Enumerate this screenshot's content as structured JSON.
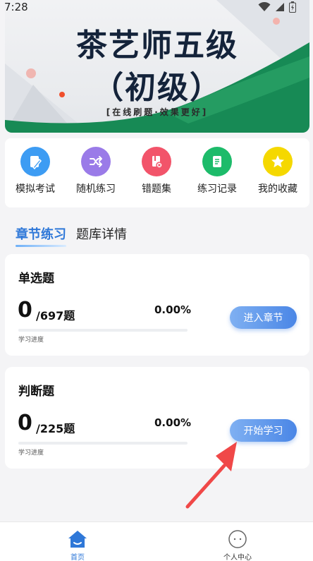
{
  "status": {
    "time": "7:28"
  },
  "banner": {
    "title_line1": "茶艺师五级",
    "title_line2": "（初级）",
    "subtitle": "[在线刷题·效果更好]"
  },
  "quick_actions": [
    {
      "label": "模拟考试",
      "icon": "exam-edit-icon",
      "color": "#3d9cf3"
    },
    {
      "label": "随机练习",
      "icon": "shuffle-icon",
      "color": "#9a7be8"
    },
    {
      "label": "错题集",
      "icon": "wrong-book-icon",
      "color": "#f2546a"
    },
    {
      "label": "练习记录",
      "icon": "record-icon",
      "color": "#1dbb6a"
    },
    {
      "label": "我的收藏",
      "icon": "star-icon",
      "color": "#f5d800"
    }
  ],
  "tabs": [
    {
      "label": "章节练习",
      "active": true
    },
    {
      "label": "题库详情",
      "active": false
    }
  ],
  "chapters": [
    {
      "name": "单选题",
      "done": "0",
      "total": "/697题",
      "percent": "0.00%",
      "progress": 0,
      "progress_label": "学习进度",
      "button": "进入章节"
    },
    {
      "name": "判断题",
      "done": "0",
      "total": "/225题",
      "percent": "0.00%",
      "progress": 0,
      "progress_label": "学习进度",
      "button": "开始学习"
    }
  ],
  "nav": [
    {
      "label": "首页",
      "icon": "home-icon",
      "active": true
    },
    {
      "label": "个人中心",
      "icon": "profile-icon",
      "active": false
    }
  ]
}
